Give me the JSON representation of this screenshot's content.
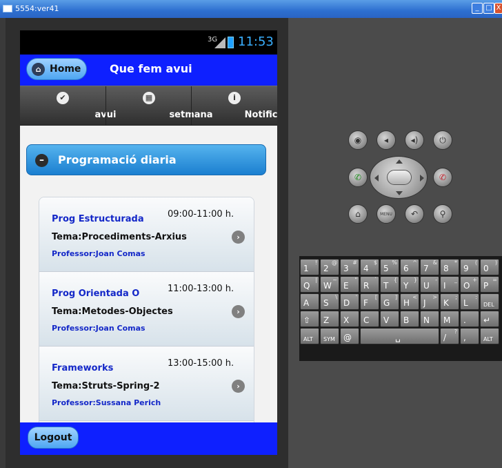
{
  "window": {
    "title": "5554:ver41",
    "min_label": "_",
    "max_label": "□",
    "close_label": "X"
  },
  "status_bar": {
    "network": "3G",
    "time": "11:53"
  },
  "header": {
    "home_label": "Home",
    "title": "Que fem avui"
  },
  "navbar": {
    "tabs": [
      {
        "label": "avui",
        "icon": "check-icon"
      },
      {
        "label": "setmana",
        "icon": "grid-icon"
      },
      {
        "label": "Notificacions",
        "icon": "info-icon"
      }
    ]
  },
  "section": {
    "title": "Programació diaria"
  },
  "schedule": [
    {
      "time": "09:00-11:00 h.",
      "subject": "Prog Estructurada",
      "tema": "Tema:Procediments-Arxius",
      "professor": "Professor:Joan Comas"
    },
    {
      "time": "11:00-13:00 h.",
      "subject": "Prog Orientada O",
      "tema": "Tema:Metodes-Objectes",
      "professor": "Professor:Joan Comas"
    },
    {
      "time": "13:00-15:00 h.",
      "subject": "Frameworks",
      "tema": "Tema:Struts-Spring-2",
      "professor": "Professor:Sussana Perich"
    }
  ],
  "footer": {
    "logout_label": "Logout"
  },
  "keyboard": {
    "rows": [
      [
        [
          "1",
          "!"
        ],
        [
          "2",
          "@"
        ],
        [
          "3",
          "#"
        ],
        [
          "4",
          "$"
        ],
        [
          "5",
          "%"
        ],
        [
          "6",
          "^"
        ],
        [
          "7",
          "&"
        ],
        [
          "8",
          "*"
        ],
        [
          "9",
          "("
        ],
        [
          "0",
          ")"
        ]
      ],
      [
        [
          "Q",
          "|"
        ],
        [
          "W",
          "~"
        ],
        [
          "E",
          "\""
        ],
        [
          "R",
          "`"
        ],
        [
          "T",
          "{"
        ],
        [
          "Y",
          "}"
        ],
        [
          "U",
          "-"
        ],
        [
          "I",
          "_"
        ],
        [
          "O",
          "+"
        ],
        [
          "P",
          "="
        ]
      ],
      [
        [
          "A",
          ""
        ],
        [
          "S",
          "\\"
        ],
        [
          "D",
          "'"
        ],
        [
          "F",
          "["
        ],
        [
          "G",
          "]"
        ],
        [
          "H",
          "<"
        ],
        [
          "J",
          ">"
        ],
        [
          "K",
          ";"
        ],
        [
          "L",
          ":"
        ],
        [
          "DEL",
          ""
        ]
      ],
      [
        [
          "⇧",
          ""
        ],
        [
          "Z",
          ""
        ],
        [
          "X",
          ""
        ],
        [
          "C",
          ""
        ],
        [
          "V",
          ""
        ],
        [
          "B",
          ""
        ],
        [
          "N",
          ""
        ],
        [
          "M",
          ""
        ],
        [
          ".",
          ""
        ],
        [
          "↵",
          ""
        ]
      ]
    ],
    "bottom": {
      "alt": "ALT",
      "sym": "SYM",
      "at": "@",
      "space": "␣",
      "slash": "/",
      "slash_alt": "?",
      "comma": ",",
      "alt2": "ALT"
    }
  },
  "colors": {
    "header_blue": "#0e20ff",
    "accent_blue": "#1b7fd0",
    "clock_blue": "#3ab0ff"
  }
}
